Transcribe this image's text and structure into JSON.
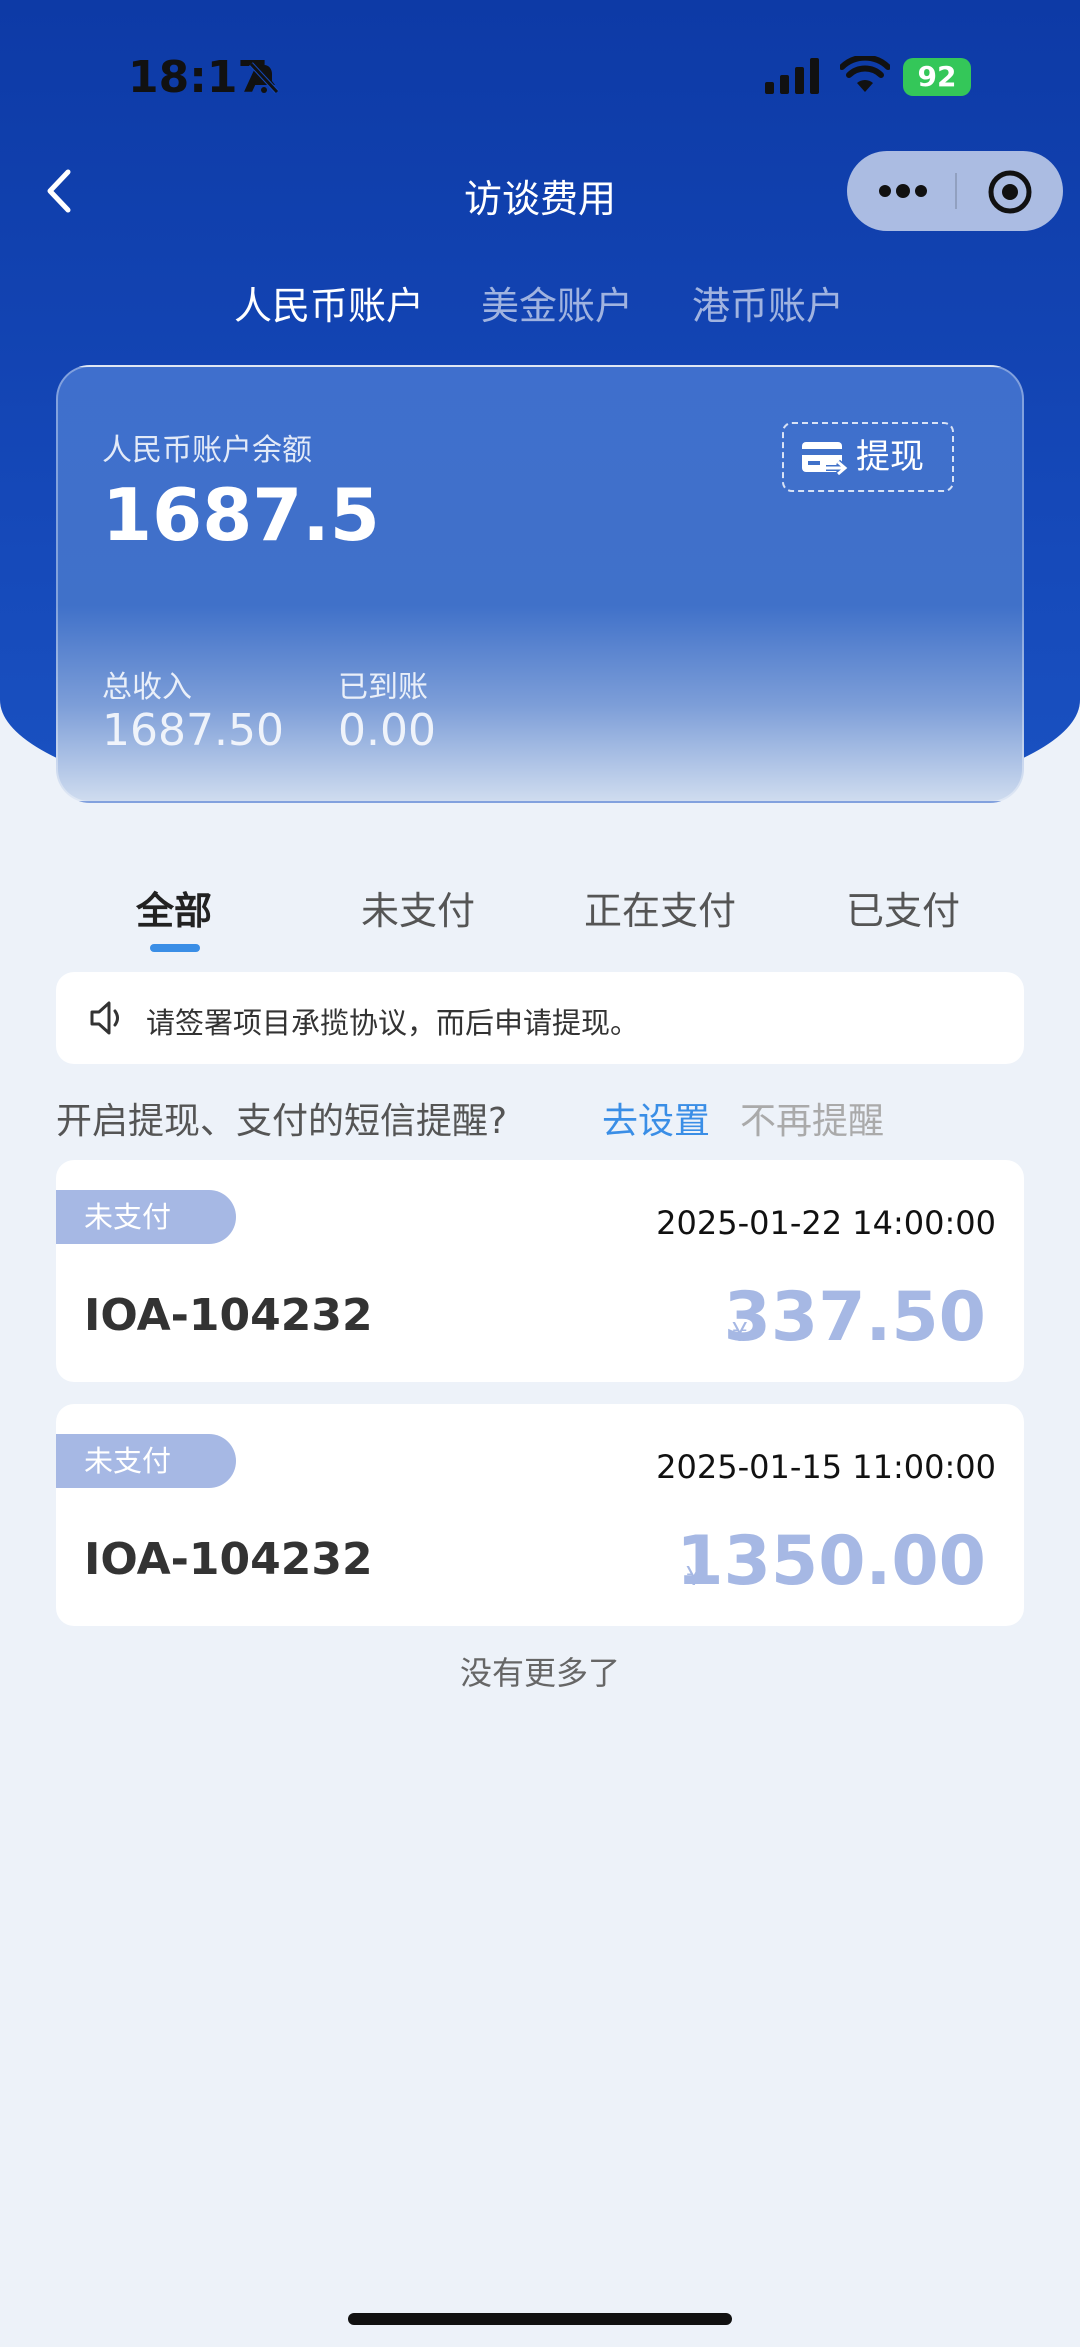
{
  "status_bar": {
    "time": "18:17",
    "battery": "92"
  },
  "nav": {
    "title": "访谈费用"
  },
  "currency_tabs": [
    {
      "label": "人民币账户",
      "active": true
    },
    {
      "label": "美金账户",
      "active": false
    },
    {
      "label": "港币账户",
      "active": false
    }
  ],
  "balance_card": {
    "label": "人民币账户余额",
    "balance": "1687.5",
    "withdraw_label": "提现",
    "total_income_label": "总收入",
    "total_income": "1687.50",
    "received_label": "已到账",
    "received": "0.00"
  },
  "status_tabs": [
    {
      "label": "全部",
      "active": true
    },
    {
      "label": "未支付",
      "active": false
    },
    {
      "label": "正在支付",
      "active": false
    },
    {
      "label": "已支付",
      "active": false
    }
  ],
  "notice": {
    "text": "请签署项目承揽协议，而后申请提现。"
  },
  "sms": {
    "question": "开启提现、支付的短信提醒?",
    "set_label": "去设置",
    "dismiss_label": "不再提醒"
  },
  "records": [
    {
      "status": "未支付",
      "time": "2025-01-22 14:00:00",
      "code": "IOA-104232",
      "currency": "¥",
      "amount": "337.50"
    },
    {
      "status": "未支付",
      "time": "2025-01-15 11:00:00",
      "code": "IOA-104232",
      "currency": "¥",
      "amount": "1350.00"
    }
  ],
  "footer": {
    "no_more": "没有更多了"
  },
  "colors": {
    "primary": "#1548b8",
    "accent": "#3a8ee6",
    "badge": "#a6b8e4"
  }
}
